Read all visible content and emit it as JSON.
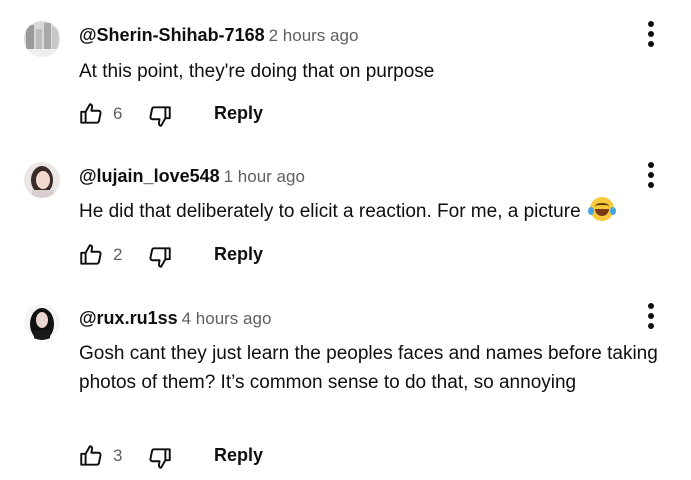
{
  "comments": [
    {
      "author": "@Sherin-Shihab-7168",
      "time": "2 hours ago",
      "text": "At this point, they're doing that on purpose",
      "likes": "6",
      "reply_label": "Reply"
    },
    {
      "author": "@lujain_love548",
      "time": "1 hour ago",
      "text": "He did that deliberately to elicit a reaction. For me, a picture",
      "likes": "2",
      "reply_label": "Reply"
    },
    {
      "author": "@rux.ru1ss",
      "time": "4 hours ago",
      "text": "Gosh cant they just learn the peoples faces and names before taking photos of them? It’s common sense to do that, so annoying",
      "likes": "3",
      "reply_label": "Reply"
    }
  ],
  "icons": {
    "like": "thumbs-up-icon",
    "dislike": "thumbs-down-icon",
    "more": "more-vertical-icon",
    "emoji": "face-with-tears-of-joy-emoji"
  }
}
